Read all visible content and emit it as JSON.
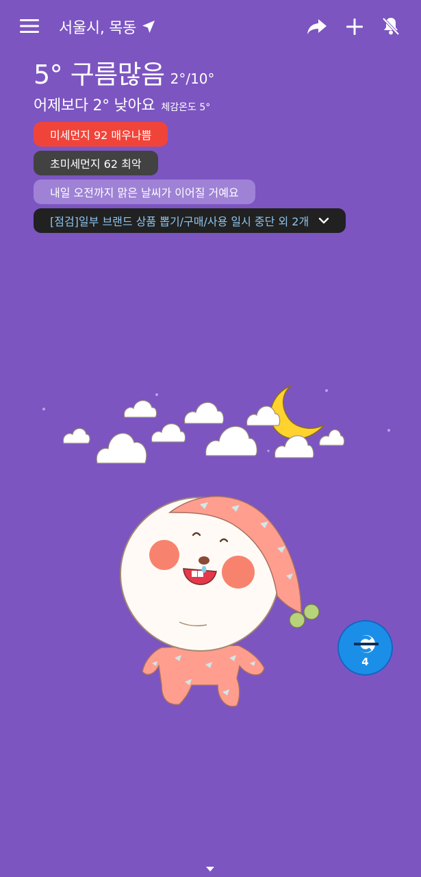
{
  "header": {
    "location": "서울시, 목동",
    "icons": [
      "menu-icon",
      "location-arrow-icon",
      "share-icon",
      "add-icon",
      "notifications-off-icon"
    ]
  },
  "weather": {
    "temp_desc": "5° 구름많음",
    "minmax": "2°/10°",
    "compare": "어제보다 2° 낮아요",
    "feels": "체감온도 5°"
  },
  "alerts": {
    "fine_dust": "미세먼지 92 매우나쁨",
    "ultrafine_dust": "초미세먼지 62 최악",
    "forecast": "내일 오전까지 맑은 날씨가 이어질 거예요",
    "notice": "[점검]일부 브랜드 상품 뽑기/구매/사용 일시 중단 외 2개"
  },
  "badge": {
    "count": "4"
  },
  "colors": {
    "background": "#7c55c1",
    "fine_dust": "#f0443a",
    "ultrafine_dust": "#424242",
    "forecast": "#9f82d6",
    "notice_bg": "#212121",
    "notice_text": "#8fc5ef",
    "badge": "#1b8fe8"
  }
}
